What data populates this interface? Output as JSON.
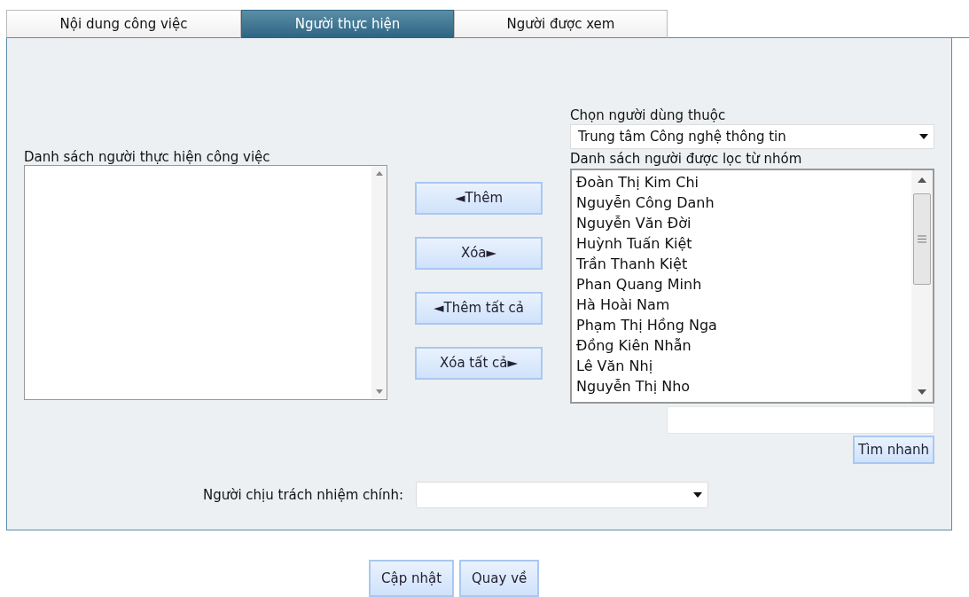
{
  "tabs": [
    {
      "label": "Nội dung công việc",
      "selected": false
    },
    {
      "label": "Người thực hiện",
      "selected": true
    },
    {
      "label": "Người được xem",
      "selected": false
    }
  ],
  "assignee_list": {
    "label": "Danh sách người thực hiện công việc"
  },
  "transfer_buttons": [
    "◄Thêm",
    "Xóa►",
    "◄Thêm tất cả",
    "Xóa tất cả►"
  ],
  "group_select": {
    "label": "Chọn người dùng thuộc",
    "value": "Trung tâm Công nghệ thông tin"
  },
  "filtered_list": {
    "label": "Danh sách người được lọc từ nhóm",
    "items": [
      "Đoàn Thị Kim Chi",
      "Nguyễn Công Danh",
      "Nguyễn Văn Đời",
      "Huỳnh Tuấn Kiệt",
      "Trần Thanh Kiệt",
      "Phan Quang Minh",
      "Hà Hoài Nam",
      "Phạm Thị Hồng Nga",
      "Đồng Kiên Nhẫn",
      "Lê Văn Nhị",
      "Nguyễn Thị Nho"
    ]
  },
  "quick_search": {
    "button": "Tìm nhanh"
  },
  "main_responsible": {
    "label": "Người chịu trách nhiệm chính:"
  },
  "actions": [
    "Cập nhật",
    "Quay về"
  ]
}
